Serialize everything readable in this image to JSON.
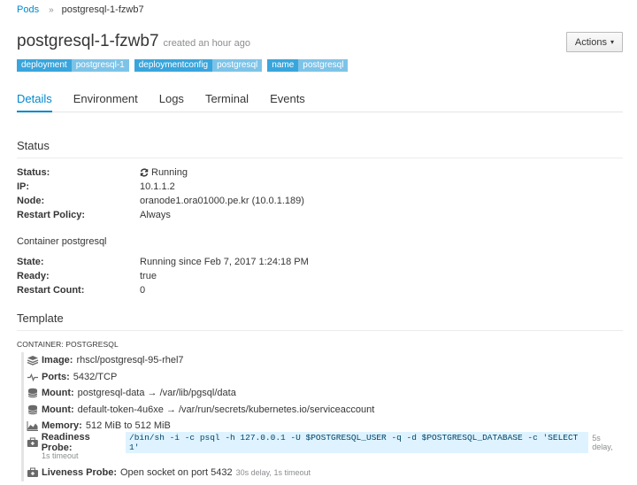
{
  "breadcrumb": {
    "parent": "Pods",
    "separator": "»",
    "current": "postgresql-1-fzwb7"
  },
  "header": {
    "title": "postgresql-1-fzwb7",
    "subtitle": "created an hour ago",
    "actions_label": "Actions"
  },
  "labels": [
    {
      "key": "deployment",
      "value": "postgresql-1"
    },
    {
      "key": "deploymentconfig",
      "value": "postgresql"
    },
    {
      "key": "name",
      "value": "postgresql"
    }
  ],
  "tabs": [
    {
      "label": "Details",
      "active": true
    },
    {
      "label": "Environment",
      "active": false
    },
    {
      "label": "Logs",
      "active": false
    },
    {
      "label": "Terminal",
      "active": false
    },
    {
      "label": "Events",
      "active": false
    }
  ],
  "status": {
    "title": "Status",
    "rows": [
      {
        "key": "Status:",
        "value": "Running",
        "icon": "refresh-icon"
      },
      {
        "key": "IP:",
        "value": "10.1.1.2"
      },
      {
        "key": "Node:",
        "value": "oranode1.ora01000.pe.kr (10.0.1.189)"
      },
      {
        "key": "Restart Policy:",
        "value": "Always"
      }
    ]
  },
  "container": {
    "title": "Container postgresql",
    "rows": [
      {
        "key": "State:",
        "value": "Running since Feb 7, 2017 1:24:18 PM"
      },
      {
        "key": "Ready:",
        "value": "true"
      },
      {
        "key": "Restart Count:",
        "value": "0"
      }
    ]
  },
  "template": {
    "title": "Template",
    "container_label": "CONTAINER: POSTGRESQL",
    "image": {
      "key": "Image:",
      "value": "rhscl/postgresql-95-rhel7",
      "icon": "layers-icon"
    },
    "ports": {
      "key": "Ports:",
      "value": "5432/TCP",
      "icon": "pulse-icon"
    },
    "mount1": {
      "key": "Mount:",
      "value": "postgresql-data → /var/lib/pgsql/data",
      "icon": "database-icon"
    },
    "mount2": {
      "key": "Mount:",
      "value": "default-token-4u6xe → /var/run/secrets/kubernetes.io/serviceaccount",
      "icon": "database-icon"
    },
    "memory": {
      "key": "Memory:",
      "value": "512 MiB to 512 MiB",
      "icon": "area-chart-icon"
    },
    "readiness": {
      "key": "Readiness Probe:",
      "command": "/bin/sh -i -c psql -h 127.0.0.1 -U $POSTGRESQL_USER -q -d $POSTGRESQL_DATABASE -c 'SELECT 1'",
      "delay": "5s delay,",
      "timeout": "1s timeout",
      "icon": "medkit-icon"
    },
    "liveness": {
      "key": "Liveness Probe:",
      "value": "Open socket on port 5432",
      "delay": "30s delay, 1s timeout",
      "icon": "medkit-icon"
    }
  },
  "colors": {
    "link": "#0088ce",
    "label_key": "#39a5dc",
    "label_value": "#7dc3e8"
  }
}
